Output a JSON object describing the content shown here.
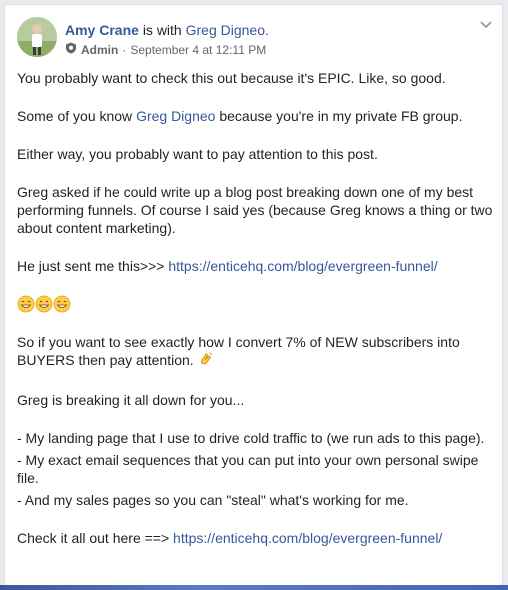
{
  "post": {
    "author": "Amy Crane",
    "is_with_text": "is with",
    "tagged": "Greg Digneo.",
    "role": "Admin",
    "separator": "·",
    "timestamp": "September 4 at 12:11 PM",
    "paragraphs": {
      "p1": "You probably want to check this out because it's EPIC. Like, so good.",
      "p2a": "Some of you know",
      "p2_link": "Greg Digneo",
      "p2b": "because you're in my private FB group.",
      "p3": "Either way, you probably want to pay attention to this post.",
      "p4": "Greg asked if he could write up a blog post breaking down one of my best performing funnels. Of course I said yes (because Greg knows a thing or two about content marketing).",
      "p5a": "He just sent me this>>>",
      "p5_link": "https://enticehq.com/blog/evergreen-funnel/",
      "p7": "So if you want to see exactly how I convert 7% of NEW subscribers into BUYERS then pay attention.",
      "p8": "Greg is breaking it all down for you...",
      "b1": "- My landing page that I use to drive cold traffic to (we run ads to this page).",
      "b2": "- My exact email sequences that you can put into your own personal swipe file.",
      "b3": "- And my sales pages so you can \"steal\" what's working for me.",
      "p9a": "Check it all out here ==>",
      "p9_link": "https://enticehq.com/blog/evergreen-funnel/"
    },
    "emoji": [
      "grinning-face-emoji",
      "grinning-face-emoji",
      "grinning-face-emoji",
      "clapping-hands-emoji"
    ]
  },
  "colors": {
    "link": "#365899",
    "text": "#1d2129",
    "meta": "#616770",
    "background": "#e9ebee"
  }
}
